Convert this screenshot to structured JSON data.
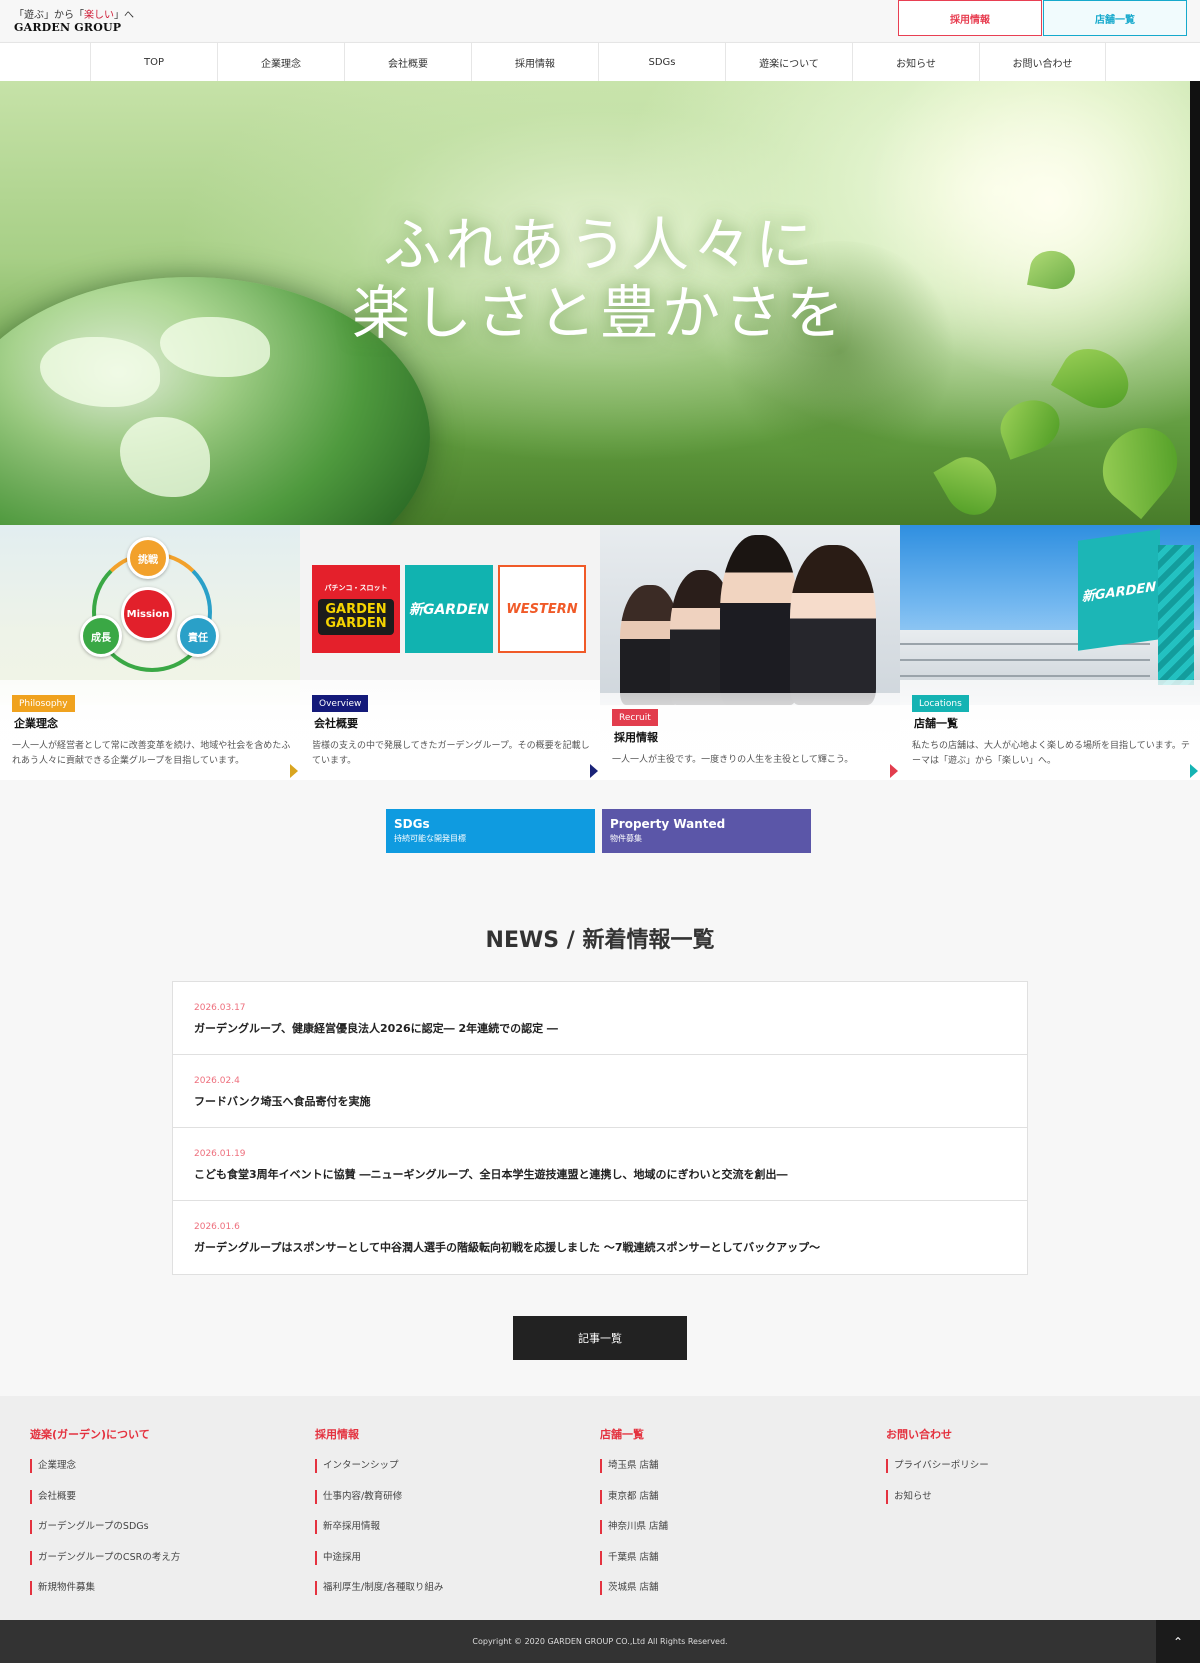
{
  "header": {
    "logo_line1_pre": "「遊ぶ」から「",
    "logo_line1_red": "楽しい",
    "logo_line1_post": "」へ",
    "logo_line2": "GARDEN GROUP",
    "recruit_button": "採用情報",
    "store_button": "店舗一覧"
  },
  "nav": {
    "items": [
      "TOP",
      "企業理念",
      "会社概要",
      "採用情報",
      "SDGs",
      "遊楽について",
      "お知らせ",
      "お問い合わせ"
    ]
  },
  "hero": {
    "line1": "ふれあう人々に",
    "line2": "楽しさと豊かさを"
  },
  "cards": [
    {
      "tag": "Philosophy",
      "tag_color": "#f0a21e",
      "title": "企業理念",
      "desc": "一人一人が経営者として常に改善変革を続け、地域や社会を含めたふれあう人々に貢献できる企業グループを目指しています。",
      "arrow_color": "#d9a520"
    },
    {
      "tag": "Overview",
      "tag_color": "#141a7a",
      "title": "会社概要",
      "desc": "皆様の支えの中で発展してきたガーデングループ。その概要を記載しています。",
      "arrow_color": "#1a2378"
    },
    {
      "tag": "Recruit",
      "tag_color": "#e23d4d",
      "title": "採用情報",
      "desc": "一人一人が主役です。一度きりの人生を主役として輝こう。",
      "arrow_color": "#e23d4d"
    },
    {
      "tag": "Locations",
      "tag_color": "#15b3b3",
      "title": "店舗一覧",
      "desc": "私たちの店舗は、大人が心地よく楽しめる場所を目指しています。テーマは「遊ぶ」から「楽しい」へ。",
      "arrow_color": "#15b3b3"
    }
  ],
  "mission": {
    "center": "Mission",
    "top": "挑戦",
    "right": "責任",
    "left": "成長"
  },
  "brands": {
    "b1_top": "パチンコ・スロット",
    "b1_main": "GARDEN GARDEN",
    "b2_main": "新GARDEN",
    "b3_main": "WESTERN"
  },
  "building_sign": "新GARDEN",
  "pills": {
    "sdgs_title": "SDGs",
    "sdgs_sub": "持続可能な開発目標",
    "prop_title": "Property Wanted",
    "prop_sub": "物件募集"
  },
  "news": {
    "heading": "NEWS / 新着情報一覧",
    "items": [
      {
        "date": "2026.03.17",
        "title": "ガーデングループ、健康経営優良法人2026に認定― 2年連続での認定 ―"
      },
      {
        "date": "2026.02.4",
        "title": "フードバンク埼玉へ食品寄付を実施"
      },
      {
        "date": "2026.01.19",
        "title": "こども食堂3周年イベントに協賛 ―ニューギングループ、全日本学生遊技連盟と連携し、地域のにぎわいと交流を創出―"
      },
      {
        "date": "2026.01.6",
        "title": "ガーデングループはスポンサーとして中谷潤人選手の階級転向初戦を応援しました 〜7戦連続スポンサーとしてバックアップ〜"
      }
    ],
    "more_button": "記事一覧"
  },
  "footer": {
    "columns": [
      {
        "heading": "遊楽(ガーデン)について",
        "links": [
          "企業理念",
          "会社概要",
          "ガーデングループのSDGs",
          "ガーデングループのCSRの考え方",
          "新規物件募集"
        ]
      },
      {
        "heading": "採用情報",
        "links": [
          "インターンシップ",
          "仕事内容/教育研修",
          "新卒採用情報",
          "中途採用",
          "福利厚生/制度/各種取り組み"
        ]
      },
      {
        "heading": "店舗一覧",
        "links": [
          "埼玉県 店舗",
          "東京都 店舗",
          "神奈川県 店舗",
          "千葉県 店舗",
          "茨城県 店舗"
        ]
      },
      {
        "heading": "お問い合わせ",
        "links": [
          "プライバシーポリシー",
          "お知らせ"
        ]
      }
    ],
    "copyright": "Copyright © 2020 GARDEN GROUP CO.,Ltd All Rights Reserved.",
    "totop_icon": "chevron-up-icon"
  }
}
